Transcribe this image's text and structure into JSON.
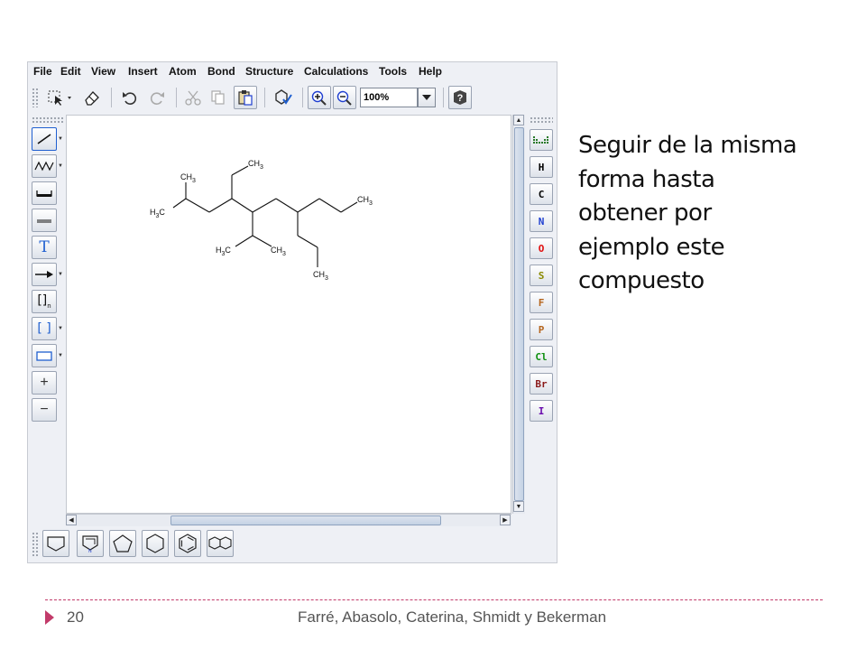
{
  "menu": [
    "File",
    "Edit",
    "View",
    "Insert",
    "Atom",
    "Bond",
    "Structure",
    "Calculations",
    "Tools",
    "Help"
  ],
  "toolbar": {
    "zoom_value": "100%",
    "icons": [
      "select-icon",
      "eraser-icon",
      "undo-icon",
      "redo-icon",
      "cut-icon",
      "copy-icon",
      "paste-icon",
      "clean-structure-icon",
      "zoom-in-icon",
      "zoom-out-icon",
      "help-icon"
    ]
  },
  "left_tools": {
    "text_tool_label": "T",
    "plus_label": "+",
    "minus_label": "−",
    "bracket_label": "[ ]",
    "repeat_bracket_label": "[]",
    "repeat_sub": "n"
  },
  "right_tools": {
    "elements": [
      {
        "symbol": "H",
        "color": "#000000"
      },
      {
        "symbol": "C",
        "color": "#000000"
      },
      {
        "symbol": "N",
        "color": "#1f3fd0"
      },
      {
        "symbol": "O",
        "color": "#e01010"
      },
      {
        "symbol": "S",
        "color": "#8a8a00"
      },
      {
        "symbol": "F",
        "color": "#b5651d"
      },
      {
        "symbol": "P",
        "color": "#b5651d"
      },
      {
        "symbol": "Cl",
        "color": "#109010"
      },
      {
        "symbol": "Br",
        "color": "#8b1a1a"
      },
      {
        "symbol": "I",
        "color": "#6a0dad"
      }
    ]
  },
  "molecule_labels": {
    "ch3_top": "CH",
    "sub3": "3",
    "h3c": "H",
    "h3c_c": "C"
  },
  "side_text": [
    "Seguir de la misma",
    "forma hasta",
    "obtener por",
    "ejemplo este",
    "compuesto"
  ],
  "footer": {
    "page_number": "20",
    "authors": "Farré, Abasolo, Caterina, Shmidt y Bekerman"
  },
  "colors": {
    "accent": "#c23b6a"
  }
}
